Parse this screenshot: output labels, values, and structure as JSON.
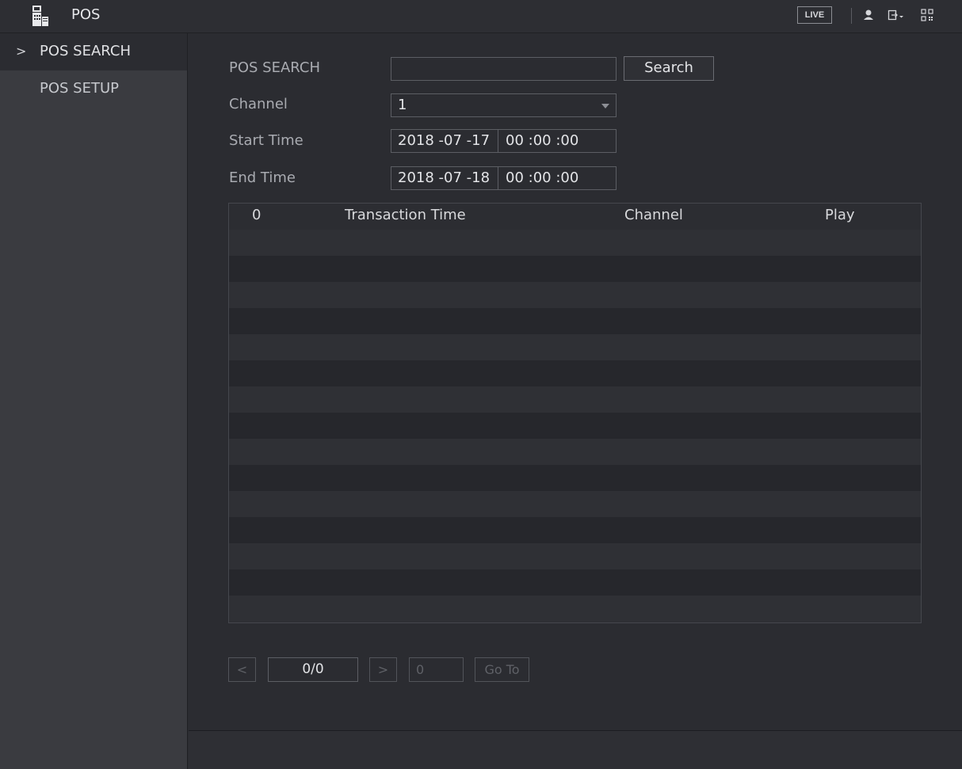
{
  "header": {
    "title": "POS",
    "live_label": "LIVE"
  },
  "sidebar": {
    "items": [
      {
        "label": "POS SEARCH",
        "chevron": ">"
      },
      {
        "label": "POS SETUP"
      }
    ]
  },
  "form": {
    "pos_search_label": "POS SEARCH",
    "pos_search_value": "",
    "search_button": "Search",
    "channel_label": "Channel",
    "channel_value": "1",
    "start_time_label": "Start Time",
    "start_date": "2018 -07 -17",
    "start_time": "00 :00 :00",
    "end_time_label": "End Time",
    "end_date": "2018 -07 -18",
    "end_time": "00 :00 :00"
  },
  "table": {
    "headers": [
      "0",
      "Transaction Time",
      "Channel",
      "Play"
    ],
    "rows": []
  },
  "pagination": {
    "prev": "<",
    "page_display": "0/0",
    "next": ">",
    "goto_value": "0",
    "goto_label": "Go To"
  }
}
